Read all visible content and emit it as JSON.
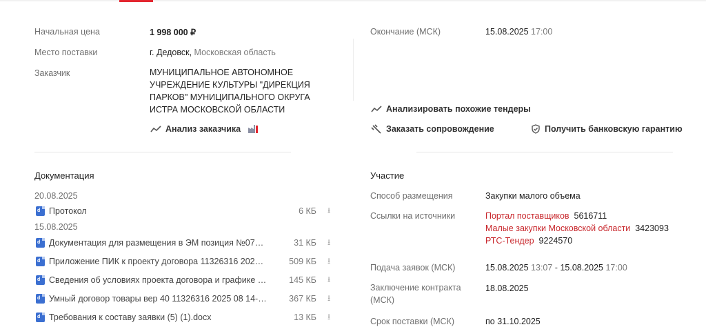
{
  "summary": {
    "price_label": "Начальная цена",
    "price_value": "1 998 000 ₽",
    "place_label": "Место поставки",
    "place_city": "г. Дедовск,",
    "place_region": "Московская область",
    "customer_label": "Заказчик",
    "customer_name": "МУНИЦИПАЛЬНОЕ АВТОНОМНОЕ УЧРЕЖДЕНИЕ КУЛЬТУРЫ \"ДИРЕКЦИЯ ПАРКОВ\" МУНИЦИПАЛЬНОГО ОКРУГА ИСТРА МОСКОВСКОЙ ОБЛАСТИ",
    "customer_analysis": "Анализ заказчика",
    "end_label": "Окончание (МСК)",
    "end_date": "15.08.2025",
    "end_time": "17:00",
    "similar_tenders": "Анализировать похожие тендеры",
    "order_support": "Заказать сопровождение",
    "bank_guarantee": "Получить банковскую гарантию"
  },
  "documentation": {
    "title": "Документация",
    "groups": [
      {
        "date": "20.08.2025",
        "files": [
          {
            "name": "Протокол",
            "size": "6 КБ"
          }
        ]
      },
      {
        "date": "15.08.2025",
        "files": [
          {
            "name": "Документация для размещения в ЭМ позиция №075504-...",
            "size": "31 КБ"
          },
          {
            "name": "Приложение ПИК к проекту договора 11326316 2025 08 ...",
            "size": "509 КБ"
          },
          {
            "name": "Сведения об условиях проекта договора и графике испо...",
            "size": "145 КБ"
          },
          {
            "name": "Умный договор товары вер 40 11326316 2025 08 14-11 3...",
            "size": "367 КБ"
          },
          {
            "name": "Требования к составу заявки (5) (1).docx",
            "size": "13 КБ"
          }
        ]
      }
    ]
  },
  "participation": {
    "title": "Участие",
    "method_label": "Способ размещения",
    "method_value": "Закупки малого объема",
    "sources_label": "Ссылки на источники",
    "sources": [
      {
        "name": "Портал поставщиков",
        "id": "5616711"
      },
      {
        "name": "Малые закупки Московской области",
        "id": "3423093"
      },
      {
        "name": "РТС-Тендер",
        "id": "9224570"
      }
    ],
    "apps_label": "Подача заявок (МСК)",
    "apps_start_date": "15.08.2025",
    "apps_start_time": "13:07",
    "apps_sep": " - ",
    "apps_end_date": "15.08.2025",
    "apps_end_time": "17:00",
    "contract_label": "Заключение контракта (МСК)",
    "contract_value": "18.08.2025",
    "delivery_label": "Срок поставки (МСК)",
    "delivery_value": "по 31.10.2025"
  },
  "colors": {
    "accent": "#e3262f",
    "link": "#c8262b"
  }
}
